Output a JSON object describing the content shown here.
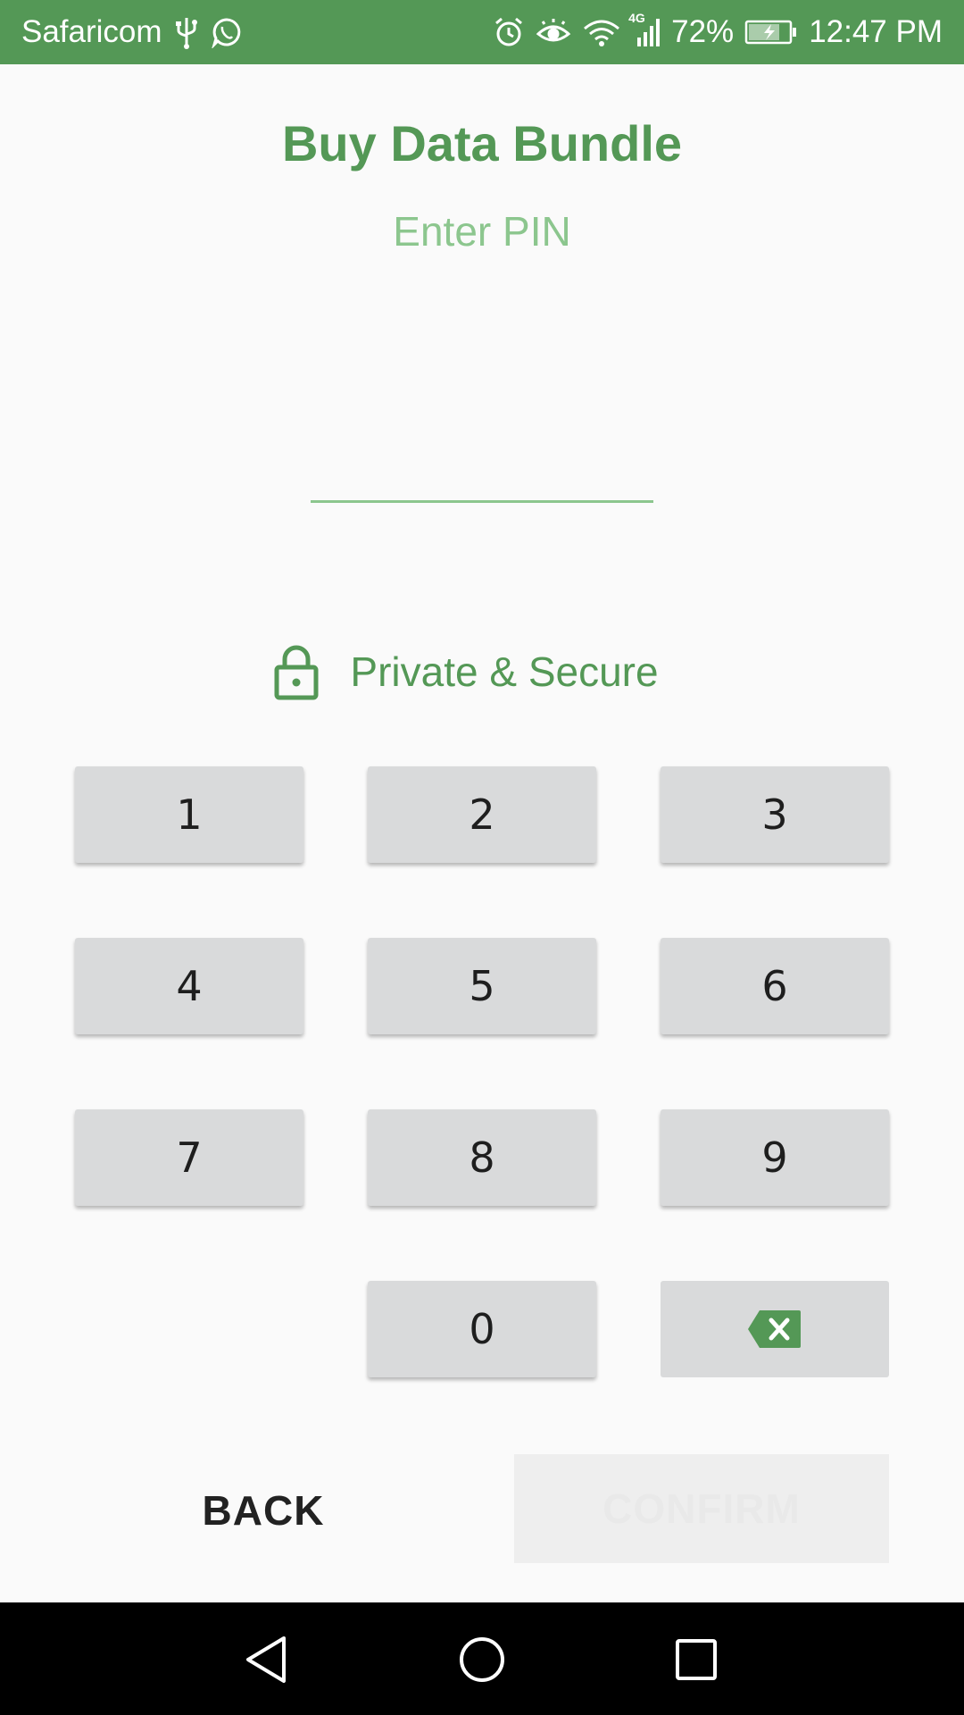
{
  "status_bar": {
    "carrier": "Safaricom",
    "network_type": "4G",
    "battery_percent": "72%",
    "time": "12:47 PM",
    "icons": [
      "usb-icon",
      "whatsapp-icon",
      "alarm-icon",
      "eye-comfort-icon",
      "wifi-icon",
      "signal-icon",
      "battery-charging-icon"
    ],
    "bar_color": "#549856"
  },
  "header": {
    "title": "Buy Data Bundle",
    "subtitle": "Enter PIN"
  },
  "pin_input": {
    "value": "",
    "placeholder": ""
  },
  "secure": {
    "icon": "lock-icon",
    "label": "Private & Secure"
  },
  "keypad": {
    "keys": [
      "1",
      "2",
      "3",
      "4",
      "5",
      "6",
      "7",
      "8",
      "9",
      "0"
    ],
    "backspace_icon": "backspace-icon"
  },
  "actions": {
    "back_label": "BACK",
    "confirm_label": "CONFIRM"
  },
  "nav_bar": {
    "buttons": [
      "back-triangle-icon",
      "home-circle-icon",
      "recents-square-icon"
    ]
  },
  "colors": {
    "primary": "#549856",
    "light_primary": "#8cc68e",
    "key_background": "#d9dadb",
    "background": "#fafafa"
  }
}
